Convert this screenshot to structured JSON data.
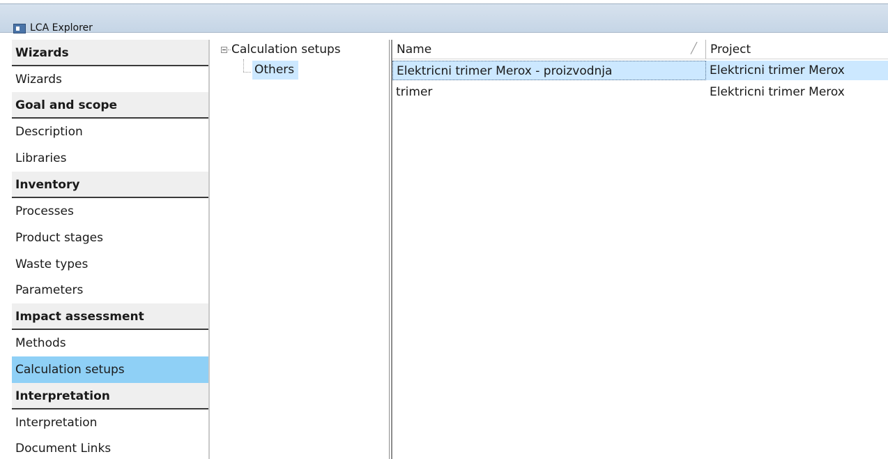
{
  "window": {
    "title": "LCA Explorer",
    "icon": "window-app-icon"
  },
  "sidebar": {
    "rows": [
      {
        "type": "header",
        "label": "Wizards"
      },
      {
        "type": "item",
        "label": "Wizards"
      },
      {
        "type": "header",
        "label": "Goal and scope"
      },
      {
        "type": "item",
        "label": "Description"
      },
      {
        "type": "item",
        "label": "Libraries"
      },
      {
        "type": "header",
        "label": "Inventory"
      },
      {
        "type": "item",
        "label": "Processes"
      },
      {
        "type": "item",
        "label": "Product stages"
      },
      {
        "type": "item",
        "label": "Waste types"
      },
      {
        "type": "item",
        "label": "Parameters"
      },
      {
        "type": "header",
        "label": "Impact assessment"
      },
      {
        "type": "item",
        "label": "Methods"
      },
      {
        "type": "item",
        "label": "Calculation setups",
        "selected": true
      },
      {
        "type": "header",
        "label": "Interpretation"
      },
      {
        "type": "item",
        "label": "Interpretation"
      },
      {
        "type": "item",
        "label": "Document Links"
      }
    ]
  },
  "tree": {
    "root_label": "Calculation setups",
    "expander": "minus",
    "child_label": "Others",
    "child_selected": true
  },
  "list": {
    "columns": [
      {
        "label": "Name",
        "sorted": true
      },
      {
        "label": "Project"
      }
    ],
    "rows": [
      {
        "name": "Elektricni trimer Merox - proizvodnja",
        "project": "Elektricni trimer Merox",
        "selected": true
      },
      {
        "name": "trimer",
        "project": "Elektricni trimer Merox",
        "selected": false
      }
    ]
  },
  "colors": {
    "selection_blue": "#8fd0f6",
    "tree_selection": "#cce8ff",
    "titlebar": "#c5d5e6",
    "header_bg": "#efefef"
  }
}
